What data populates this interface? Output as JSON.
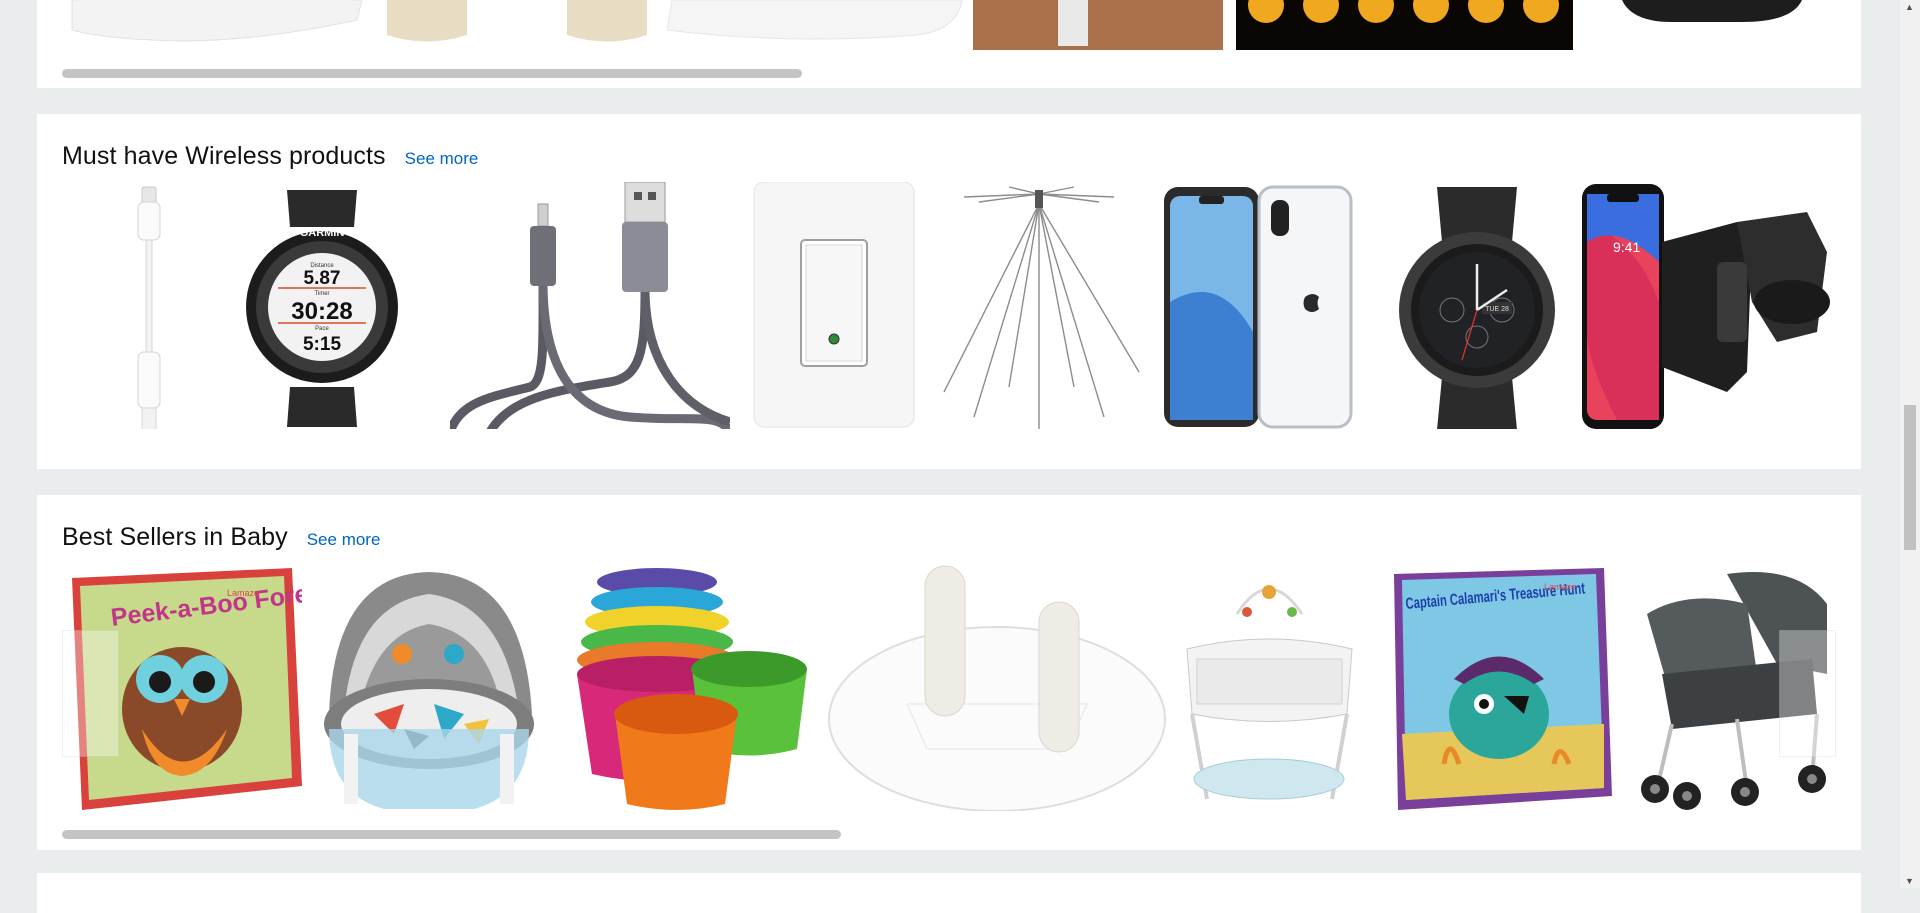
{
  "top_shelf": {
    "items": [
      "pillow",
      "flameless-candle",
      "flameless-candle",
      "pillow",
      "baseboard-heater",
      "tealight-candles",
      "device"
    ]
  },
  "wireless": {
    "title": "Must have Wireless products",
    "see_more": "See more",
    "items": [
      {
        "name": "headphone-adapter"
      },
      {
        "name": "gps-sport-watch",
        "watch_brand": "GARMIN",
        "distance_label": "Distance",
        "distance": "5.87",
        "timer_label": "Timer",
        "timer": "30:28",
        "pace_label": "Pace",
        "pace": "5:15"
      },
      {
        "name": "usb-lightning-cable"
      },
      {
        "name": "smart-light-switch"
      },
      {
        "name": "scanner-antenna"
      },
      {
        "name": "clear-phone-case"
      },
      {
        "name": "smartwatch",
        "date": "TUE 28"
      },
      {
        "name": "car-phone-mount",
        "phone_time": "9:41"
      },
      {
        "name": "partial-product"
      }
    ]
  },
  "baby": {
    "title": "Best Sellers in Baby",
    "see_more": "See more",
    "items": [
      {
        "name": "peek-a-boo-forest-book",
        "book_title": "Peek-a-Boo Forest",
        "brand": "Lamaze"
      },
      {
        "name": "baby-dome"
      },
      {
        "name": "stacking-cups"
      },
      {
        "name": "outlet-plug-cover"
      },
      {
        "name": "bassinet"
      },
      {
        "name": "treasure-hunt-book",
        "book_title": "Captain Calamari's Treasure Hunt",
        "brand": "Lamaze"
      },
      {
        "name": "double-stroller"
      }
    ]
  },
  "colors": {
    "page_bg": "#eaeded",
    "link": "#0066c0",
    "card": "#ffffff"
  }
}
